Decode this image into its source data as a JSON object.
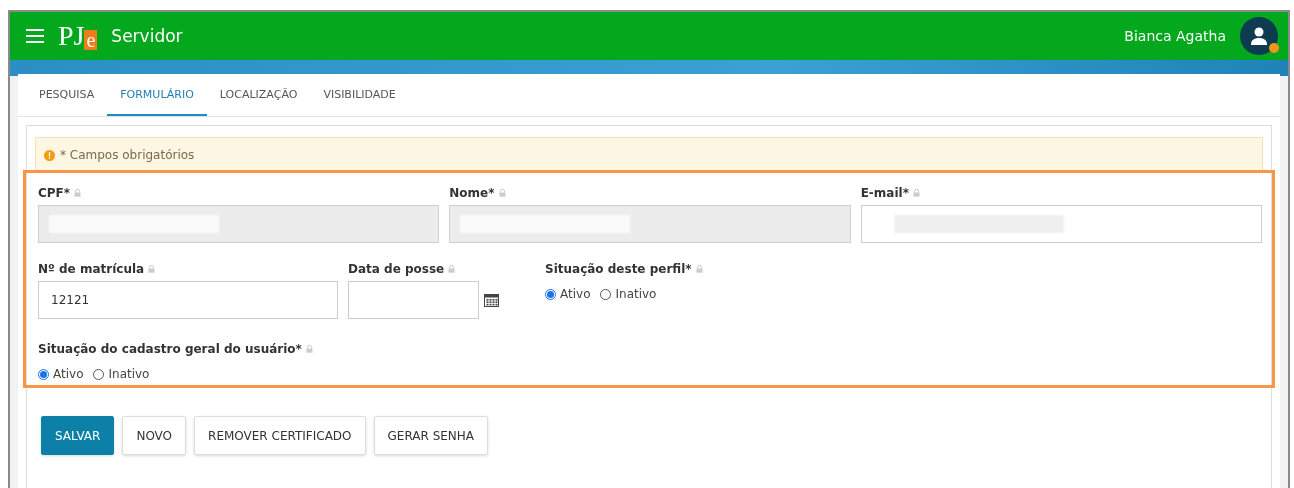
{
  "header": {
    "logo": [
      "PJ",
      "e"
    ],
    "title": "Servidor",
    "user": "Bianca Agatha",
    "user_online": true
  },
  "tabs": [
    {
      "label": "PESQUISA",
      "selected": false
    },
    {
      "label": "FORMULÁRIO",
      "selected": true
    },
    {
      "label": "LOCALIZAÇÃO",
      "selected": false
    },
    {
      "label": "VISIBILIDADE",
      "selected": false
    }
  ],
  "notice": "* Campos obrigatórios",
  "row1": [
    {
      "label": "CPF*",
      "disabled": true,
      "redacted": true
    },
    {
      "label": "Nome*",
      "disabled": true,
      "redacted": true
    },
    {
      "label": "E-mail*",
      "disabled": false,
      "redacted": true
    }
  ],
  "matricula": {
    "label": "Nº de matrícula",
    "value": "12121"
  },
  "data_posse": {
    "label": "Data de posse"
  },
  "situacao_perfil": {
    "label": "Situação deste perfil*",
    "options": [
      {
        "label": "Ativo",
        "selected": true
      },
      {
        "label": "Inativo",
        "selected": false
      }
    ]
  },
  "situacao_cadastro": {
    "label": "Situação do cadastro geral do usuário*",
    "options": [
      {
        "label": "Ativo",
        "selected": true
      },
      {
        "label": "Inativo",
        "selected": false
      }
    ]
  },
  "buttons": [
    {
      "label": "SALVAR",
      "kind": "primary"
    },
    {
      "label": "NOVO",
      "kind": "default"
    },
    {
      "label": "REMOVER CERTIFICADO",
      "kind": "default"
    },
    {
      "label": "GERAR SENHA",
      "kind": "default"
    }
  ]
}
